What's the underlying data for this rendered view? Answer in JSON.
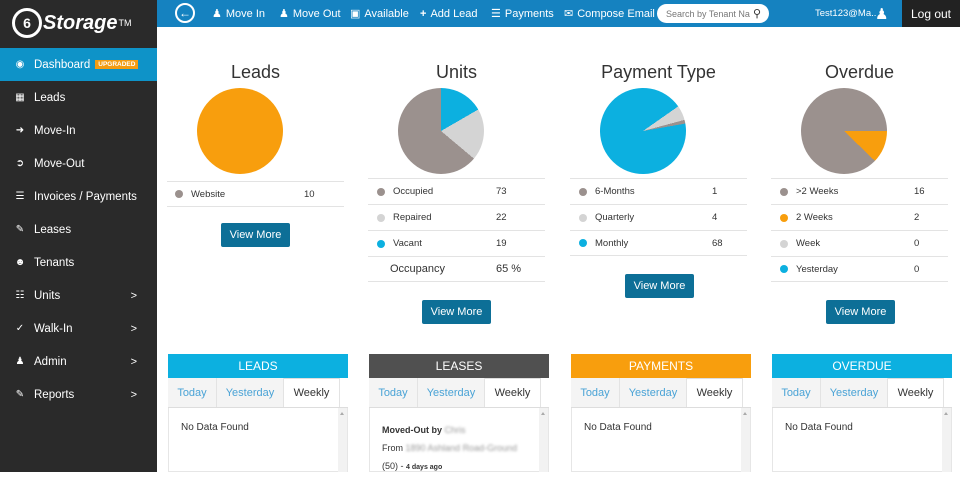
{
  "brand": {
    "logo": "Storage",
    "tm": "TM",
    "circle": "6"
  },
  "sidebar": {
    "items": [
      {
        "label": "Dashboard",
        "badge": "UPGRADED"
      },
      {
        "label": "Leads"
      },
      {
        "label": "Move-In"
      },
      {
        "label": "Move-Out"
      },
      {
        "label": "Invoices / Payments"
      },
      {
        "label": "Leases"
      },
      {
        "label": "Tenants"
      },
      {
        "label": "Units",
        "chevron": ">"
      },
      {
        "label": "Walk-In",
        "chevron": ">"
      },
      {
        "label": "Admin",
        "chevron": ">"
      },
      {
        "label": "Reports",
        "chevron": ">"
      }
    ]
  },
  "topbar": {
    "move_in": "Move In",
    "move_out": "Move Out",
    "available": "Available",
    "add_lead": "Add Lead",
    "payments": "Payments",
    "compose_email": "Compose Email",
    "search_placeholder": "Search by Tenant Na",
    "user": "Test123@Ma..",
    "logout": "Log out"
  },
  "cards": {
    "leads": {
      "title": "Leads",
      "rows": [
        {
          "label": "Website",
          "value": "10"
        }
      ],
      "view_more": "View More"
    },
    "units": {
      "title": "Units",
      "rows": [
        {
          "label": "Occupied",
          "value": "73"
        },
        {
          "label": "Repaired",
          "value": "22"
        },
        {
          "label": "Vacant",
          "value": "19"
        }
      ],
      "occupancy_label": "Occupancy",
      "occupancy_value": "65 %",
      "view_more": "View More"
    },
    "payment_type": {
      "title": "Payment Type",
      "rows": [
        {
          "label": "6-Months",
          "value": "1"
        },
        {
          "label": "Quarterly",
          "value": "4"
        },
        {
          "label": "Monthly",
          "value": "68"
        }
      ],
      "view_more": "View More"
    },
    "overdue": {
      "title": "Overdue",
      "rows": [
        {
          "label": ">2 Weeks",
          "value": "16"
        },
        {
          "label": "2 Weeks",
          "value": "2"
        },
        {
          "label": "Week",
          "value": "0"
        },
        {
          "label": "Yesterday",
          "value": "0"
        }
      ],
      "view_more": "View More"
    }
  },
  "colors": {
    "orange": "#f89e0d",
    "gray": "#9b918e",
    "light": "#d4d4d4",
    "blue": "#0cb0e0",
    "nav": "#1582c0",
    "sidebar": "#2a2a2a"
  },
  "panels": {
    "tabs": [
      "Today",
      "Yesterday",
      "Weekly"
    ],
    "leads": {
      "title": "LEADS",
      "body": "No Data Found"
    },
    "leases": {
      "title": "LEASES",
      "moved_out_prefix": "Moved-Out by",
      "moved_by": "Chris",
      "from_prefix": "From",
      "from_place": "1890 Ashland Road-Ground",
      "unit_no": "(50)",
      "dash": "-",
      "time_ago": "4 days ago"
    },
    "payments": {
      "title": "PAYMENTS",
      "body": "No Data Found"
    },
    "overdue": {
      "title": "OVERDUE",
      "body": "No Data Found"
    }
  }
}
